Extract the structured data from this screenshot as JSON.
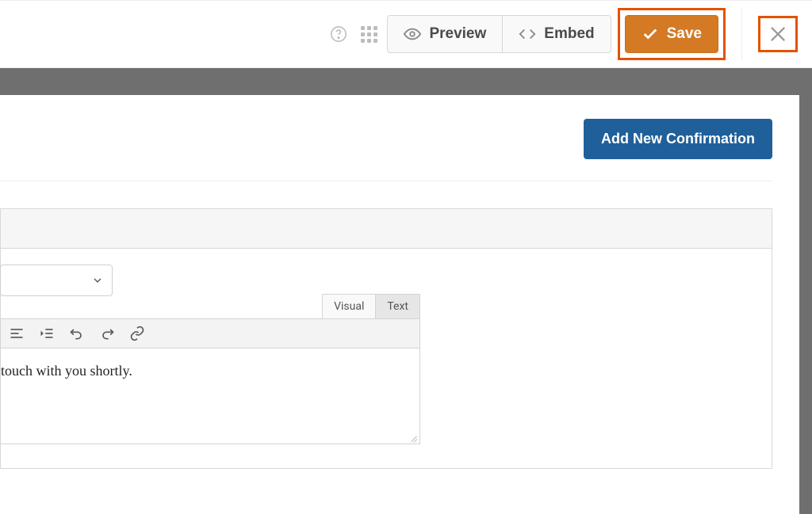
{
  "toolbar": {
    "preview_label": "Preview",
    "embed_label": "Embed",
    "save_label": "Save"
  },
  "main": {
    "add_confirmation_label": "Add New Confirmation"
  },
  "editor": {
    "tabs": {
      "visual": "Visual",
      "text": "Text"
    },
    "body_text": "touch with you shortly."
  }
}
